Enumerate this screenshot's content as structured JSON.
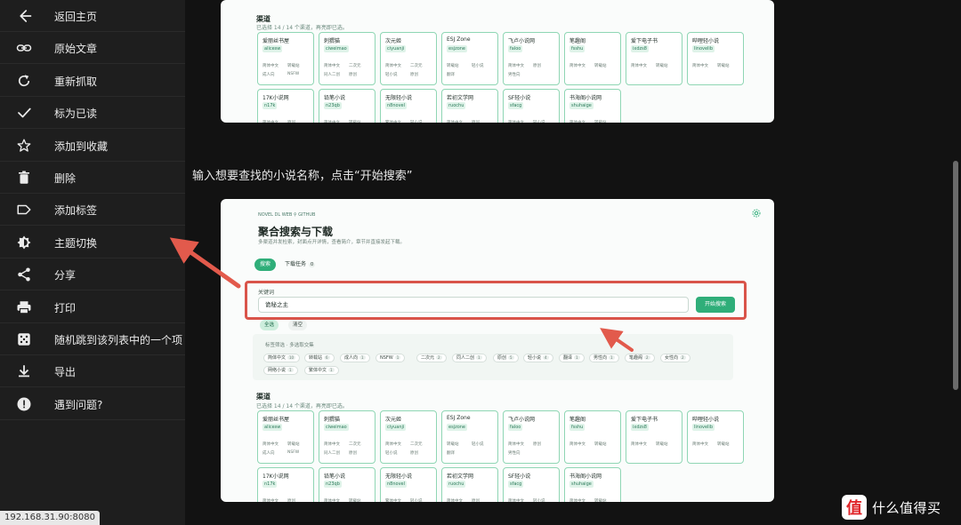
{
  "sidebar": {
    "items": [
      {
        "label": "返回主页",
        "icon": "arrow-left-icon"
      },
      {
        "label": "原始文章",
        "icon": "link-icon"
      },
      {
        "label": "重新抓取",
        "icon": "refresh-icon"
      },
      {
        "label": "标为已读",
        "icon": "check-icon"
      },
      {
        "label": "添加到收藏",
        "icon": "star-icon"
      },
      {
        "label": "删除",
        "icon": "trash-icon"
      },
      {
        "label": "添加标签",
        "icon": "label-icon"
      },
      {
        "label": "主题切换",
        "icon": "brightness-icon"
      },
      {
        "label": "分享",
        "icon": "share-icon"
      },
      {
        "label": "打印",
        "icon": "print-icon"
      },
      {
        "label": "随机跳到该列表中的一个项",
        "icon": "dice-icon"
      },
      {
        "label": "导出",
        "icon": "download-icon"
      },
      {
        "label": "遇到问题?",
        "icon": "alert-icon"
      }
    ],
    "status_url": "192.168.31.90:8080"
  },
  "article": {
    "caption": "输入想要查找的小说名称，点击“开始搜索”"
  },
  "channels": {
    "title": "渠道",
    "subtitle": "已选择 14 / 14 个渠道，再亮即已选。",
    "cards": [
      {
        "name": "爱丽丝书屋",
        "code": "alicesw",
        "tags": [
          [
            "简体中文",
            "转载站"
          ],
          [
            "成人向",
            "NSFW"
          ]
        ]
      },
      {
        "name": "刺猬猫",
        "code": "ciweimao",
        "tags": [
          [
            "简体中文",
            "二次元"
          ],
          [
            "同人二创",
            "原创"
          ]
        ]
      },
      {
        "name": "次元姬",
        "code": "ciyuanji",
        "tags": [
          [
            "简体中文",
            "二次元"
          ],
          [
            "轻小说",
            "原创"
          ]
        ]
      },
      {
        "name": "ESJ Zone",
        "code": "esjzone",
        "tags": [
          [
            "转载站",
            "轻小说"
          ],
          [
            "翻译",
            ""
          ]
        ]
      },
      {
        "name": "飞卢小说网",
        "code": "faloo",
        "tags": [
          [
            "简体中文",
            "原创"
          ],
          [
            "男性向",
            ""
          ]
        ]
      },
      {
        "name": "笔趣阁",
        "code": "fsshu",
        "tags": [
          [
            "简体中文",
            "转载站"
          ],
          [
            "",
            ""
          ]
        ]
      },
      {
        "name": "爱下电子书",
        "code": "ixdzs8",
        "tags": [
          [
            "简体中文",
            "转载站"
          ],
          [
            "",
            ""
          ]
        ]
      },
      {
        "name": "哔哩轻小说",
        "code": "linovelib",
        "tags": [
          [
            "简体中文",
            "转载站"
          ],
          [
            "",
            ""
          ]
        ]
      },
      {
        "name": "17K小说网",
        "code": "n17k",
        "tags": [
          [
            "简体中文",
            "原创"
          ],
          [
            "",
            ""
          ]
        ]
      },
      {
        "name": "铅笔小说",
        "code": "n23qb",
        "tags": [
          [
            "简体中文",
            "转载站"
          ],
          [
            "",
            ""
          ]
        ]
      },
      {
        "name": "无限轻小说",
        "code": "n8novel",
        "tags": [
          [
            "繁体中文",
            "轻小说"
          ],
          [
            "",
            ""
          ]
        ]
      },
      {
        "name": "若初文学网",
        "code": "ruochu",
        "tags": [
          [
            "简体中文",
            "原创"
          ],
          [
            "",
            ""
          ]
        ]
      },
      {
        "name": "SF轻小说",
        "code": "sfacg",
        "tags": [
          [
            "简体中文",
            "轻小说"
          ],
          [
            "",
            ""
          ]
        ]
      },
      {
        "name": "书海阁小说网",
        "code": "shuhaige",
        "tags": [
          [
            "简体中文",
            "转载站"
          ],
          [
            "",
            ""
          ]
        ]
      }
    ]
  },
  "app": {
    "badge_left": "NOVEL DL WEB",
    "badge_right": "GITHUB",
    "title": "聚合搜索与下载",
    "desc": "多渠道并发检索，封面点开详情，查看简介，章节并直接发起下载。",
    "tab_search": "搜索",
    "tab_tasks": "下载任务",
    "tab_tasks_count": "0",
    "keyword_label": "关键词",
    "keyword_value": "诡秘之主",
    "search_button": "开始搜索",
    "select_all": "全选",
    "clear": "清空",
    "tag_filter_title": "标签筛选 · 多选取交集",
    "tags_row1": [
      {
        "name": "简体中文",
        "n": "10"
      },
      {
        "name": "转载站",
        "n": "6"
      },
      {
        "name": "成人向",
        "n": "1"
      },
      {
        "name": "NSFW",
        "n": "1"
      },
      {
        "name": "二次元",
        "n": "2"
      },
      {
        "name": "同人二创",
        "n": "1"
      },
      {
        "name": "原创",
        "n": "5"
      },
      {
        "name": "轻小说",
        "n": "4"
      },
      {
        "name": "翻译",
        "n": "1"
      },
      {
        "name": "男性向",
        "n": "1"
      },
      {
        "name": "笔趣阁",
        "n": "2"
      },
      {
        "name": "女性向",
        "n": "2"
      }
    ],
    "tags_row2": [
      {
        "name": "网络小说",
        "n": "1"
      },
      {
        "name": "繁体中文",
        "n": "1"
      }
    ]
  },
  "brand": {
    "logo": "值",
    "text": "什么值得买"
  },
  "colors": {
    "accent": "#2fae79",
    "progress": "#20c4a8",
    "annotation": "#d9544a"
  }
}
